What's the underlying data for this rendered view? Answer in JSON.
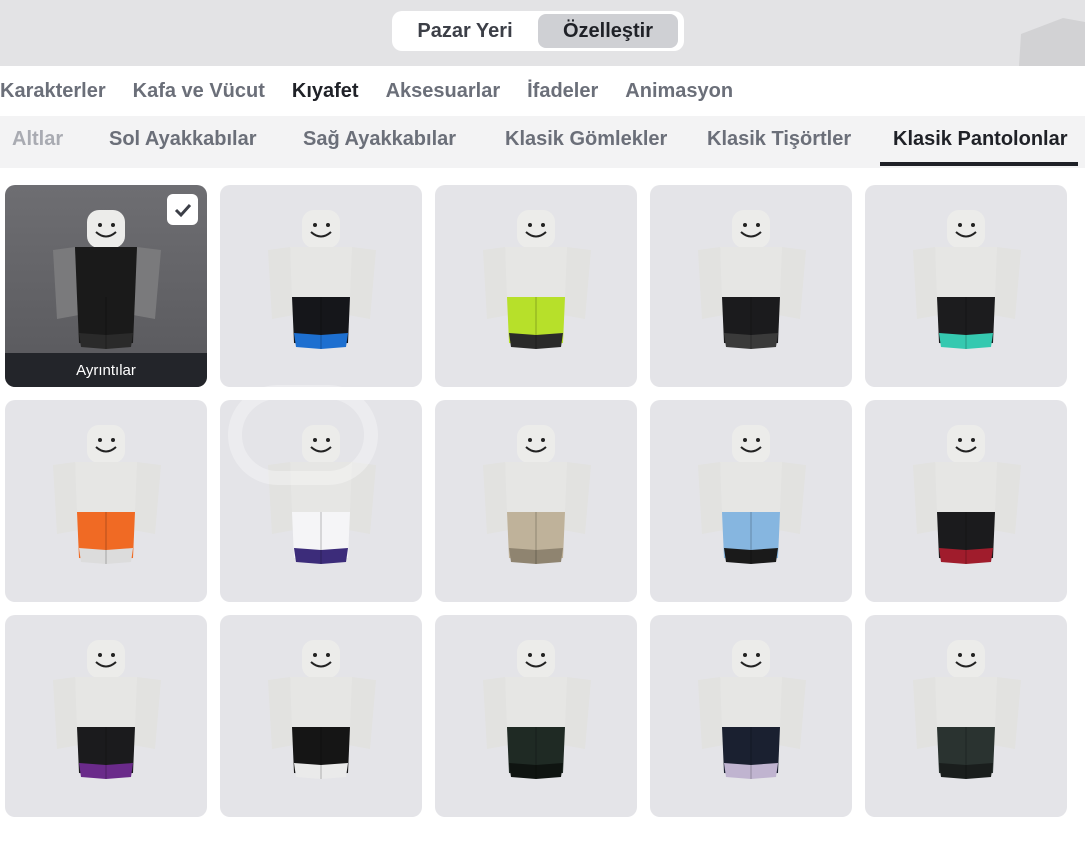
{
  "header": {
    "toggle": [
      {
        "label": "Pazar Yeri",
        "active": false
      },
      {
        "label": "Özelleştir",
        "active": true
      }
    ]
  },
  "categories": [
    {
      "label": "Karakterler",
      "active": false
    },
    {
      "label": "Kafa ve Vücut",
      "active": false
    },
    {
      "label": "Kıyafet",
      "active": true
    },
    {
      "label": "Aksesuarlar",
      "active": false
    },
    {
      "label": "İfadeler",
      "active": false
    },
    {
      "label": "Animasyon",
      "active": false
    }
  ],
  "subcategories": [
    {
      "label": "Altlar",
      "active": false
    },
    {
      "label": "Sol Ayakkabılar",
      "active": false
    },
    {
      "label": "Sağ Ayakkabılar",
      "active": false
    },
    {
      "label": "Klasik Gömlekler",
      "active": false
    },
    {
      "label": "Klasik Tişörtler",
      "active": false
    },
    {
      "label": "Klasik Pantolonlar",
      "active": true
    }
  ],
  "items": [
    {
      "selected": true,
      "details_label": "Ayrıntılar",
      "pants": [
        "#1a1a1a",
        "#2a2a2a"
      ]
    },
    {
      "selected": false,
      "pants": [
        "#15161a",
        "#1d6fd0"
      ]
    },
    {
      "selected": false,
      "pants": [
        "#b7e02a",
        "#2a2a2a"
      ]
    },
    {
      "selected": false,
      "pants": [
        "#1b1b1d",
        "#3a3a3a"
      ]
    },
    {
      "selected": false,
      "pants": [
        "#1c1c1e",
        "#35c9b0"
      ]
    },
    {
      "selected": false,
      "pants": [
        "#f06a24",
        "#dcdcdc"
      ]
    },
    {
      "selected": false,
      "pants": [
        "#f5f5f7",
        "#3c2c7a"
      ]
    },
    {
      "selected": false,
      "pants": [
        "#bfb29a",
        "#8f8470"
      ]
    },
    {
      "selected": false,
      "pants": [
        "#86b6e0",
        "#1a1a1a"
      ]
    },
    {
      "selected": false,
      "pants": [
        "#1b1b1d",
        "#a01c2c"
      ]
    },
    {
      "selected": false,
      "pants": [
        "#1b1b1d",
        "#6a2a8a"
      ]
    },
    {
      "selected": false,
      "pants": [
        "#151515",
        "#eaeaea"
      ]
    },
    {
      "selected": false,
      "pants": [
        "#1f2a24",
        "#0f1411"
      ]
    },
    {
      "selected": false,
      "pants": [
        "#1a2030",
        "#c0b4d0"
      ]
    },
    {
      "selected": false,
      "pants": [
        "#2a3330",
        "#1a1e1d"
      ]
    }
  ]
}
